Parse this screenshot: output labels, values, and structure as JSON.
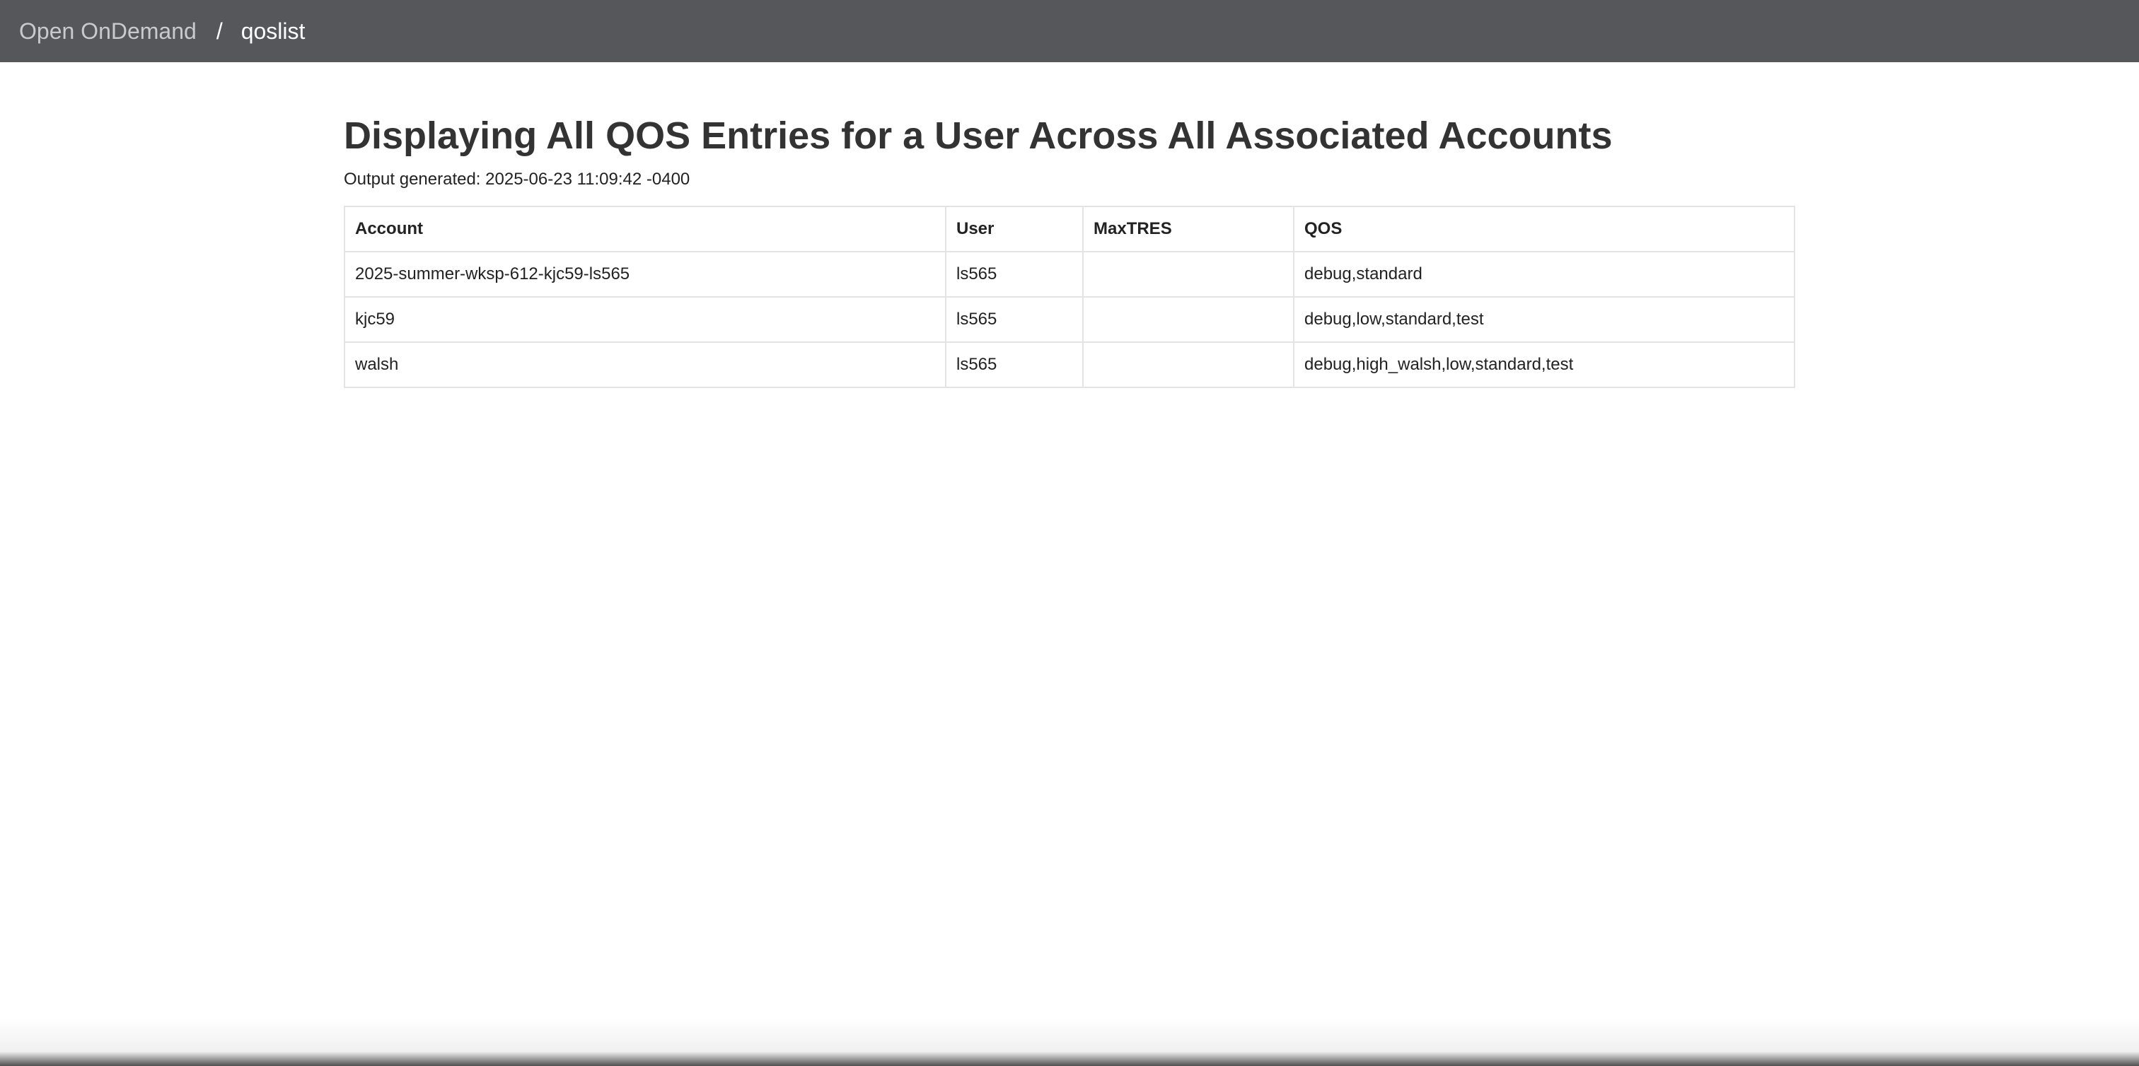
{
  "navbar": {
    "brand": "Open OnDemand",
    "separator": "/",
    "current": "qoslist"
  },
  "page": {
    "title": "Displaying All QOS Entries for a User Across All Associated Accounts",
    "generated": "Output generated: 2025-06-23 11:09:42 -0400"
  },
  "table": {
    "headers": [
      "Account",
      "User",
      "MaxTRES",
      "QOS"
    ],
    "rows": [
      [
        "2025-summer-wksp-612-kjc59-ls565",
        "ls565",
        "",
        "debug,standard"
      ],
      [
        "kjc59",
        "ls565",
        "",
        "debug,low,standard,test"
      ],
      [
        "walsh",
        "ls565",
        "",
        "debug,high_walsh,low,standard,test"
      ]
    ]
  }
}
